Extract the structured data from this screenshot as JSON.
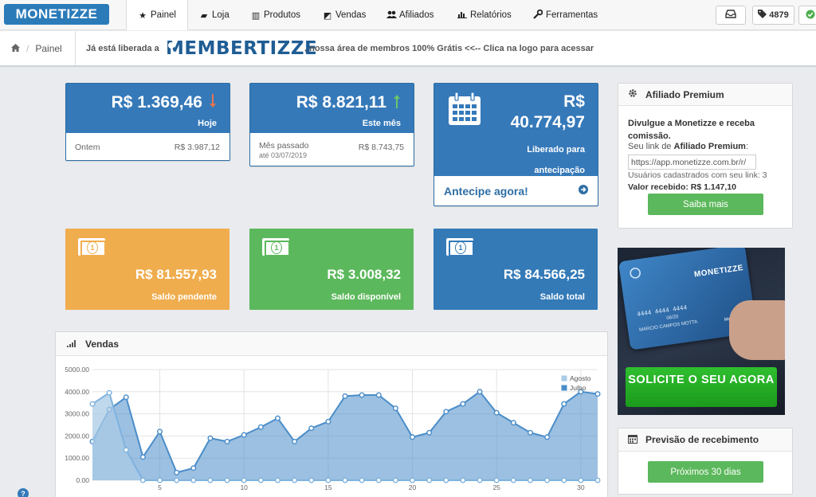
{
  "nav": {
    "logo": "MONETIZZE",
    "items": [
      {
        "label": "Painel",
        "icon": "★",
        "icon_name": "star-icon"
      },
      {
        "label": "Loja",
        "icon": "▰",
        "icon_name": "bag-icon"
      },
      {
        "label": "Produtos",
        "icon": "▥",
        "icon_name": "barcode-icon"
      },
      {
        "label": "Vendas",
        "icon": "◩",
        "icon_name": "money-icon"
      },
      {
        "label": "Afiliados",
        "icon": "👥",
        "icon_name": "users-icon"
      },
      {
        "label": "Relatórios",
        "icon": "▟",
        "icon_name": "chart-icon"
      },
      {
        "label": "Ferramentas",
        "icon": "🔧",
        "icon_name": "wrench-icon"
      }
    ],
    "inbox_icon": "inbox-icon",
    "points": "4879"
  },
  "breadcrumb": {
    "home_icon": "home-icon",
    "current": "Painel"
  },
  "notice": {
    "before": "Já está liberada a",
    "brand": "MEMBERTIZZE",
    "after": ", nossa área de membros 100% Grátis <<-- Clica na logo para acessar"
  },
  "stats": {
    "today": {
      "value": "R$ 1.369,46",
      "label": "Hoje",
      "foot_label": "Ontem",
      "foot_value": "R$ 3.987,12"
    },
    "month": {
      "value": "R$ 8.821,11",
      "label": "Este mês",
      "foot_label": "Mês passado",
      "foot_sub": "até 03/07/2019",
      "foot_value": "R$ 8.743,75"
    },
    "released": {
      "currency": "R$",
      "value": "40.774,97",
      "label": "Liberado para antecipação",
      "link": "Antecipe agora!"
    }
  },
  "balances": [
    {
      "value": "R$ 81.557,93",
      "label": "Saldo pendente",
      "color": "#f0ad4e"
    },
    {
      "value": "R$ 3.008,32",
      "label": "Saldo disponível",
      "color": "#5cb85c"
    },
    {
      "value": "R$ 84.566,25",
      "label": "Saldo total",
      "color": "#337ab7"
    }
  ],
  "affiliate": {
    "title": "Afiliado Premium",
    "desc": "Divulgue a Monetizze e receba comissão.",
    "link_label": "Seu link de",
    "link_strong": "Afiliado Premium",
    "link_value": "https://app.monetizze.com.br/r/",
    "users_text": "Usuários cadastrados com seu link: 3",
    "received_label": "Valor recebido:",
    "received_value": "R$ 1.147,10",
    "button": "Saiba mais"
  },
  "card_promo": {
    "brand": "MONETIZZE",
    "number": "4444 4444 4444",
    "date": "06/20",
    "holder": "MARCIO CAMPOS MOTTA",
    "network": "MasterCard",
    "cta": "SOLICITE O SEU AGORA"
  },
  "forecast": {
    "title": "Previsão de recebimento",
    "button": "Próximos 30 dias"
  },
  "sales_panel": {
    "title": "Vendas"
  },
  "chart_data": {
    "type": "area",
    "title": "",
    "xlabel": "",
    "ylabel": "",
    "ylim": [
      0,
      5000
    ],
    "y_ticks": [
      "0.00",
      "1000.00",
      "2000.00",
      "3000.00",
      "4000.00",
      "5000.00"
    ],
    "x_ticks": [
      5,
      10,
      15,
      20,
      25,
      30
    ],
    "xlim": [
      1,
      31
    ],
    "grid": true,
    "legend": "top-right",
    "series": [
      {
        "name": "Agosto",
        "color": "#a9cbe6",
        "x": [
          1,
          2,
          3,
          4,
          5,
          6,
          7,
          8,
          9,
          10,
          11,
          12,
          13,
          14,
          15,
          16,
          17,
          18,
          19,
          20,
          21,
          22,
          23,
          24,
          25,
          26,
          27,
          28,
          29,
          30,
          31
        ],
        "values": [
          3450,
          3950,
          1370,
          0,
          0,
          0,
          0,
          0,
          0,
          0,
          0,
          0,
          0,
          0,
          0,
          0,
          0,
          0,
          0,
          0,
          0,
          0,
          0,
          0,
          0,
          0,
          0,
          0,
          0,
          0,
          0
        ]
      },
      {
        "name": "Julho",
        "color": "#4a8dc9",
        "x": [
          1,
          2,
          3,
          4,
          5,
          6,
          7,
          8,
          9,
          10,
          11,
          12,
          13,
          14,
          15,
          16,
          17,
          18,
          19,
          20,
          21,
          22,
          23,
          24,
          25,
          26,
          27,
          28,
          29,
          30,
          31
        ],
        "values": [
          1750,
          3200,
          3750,
          1050,
          2200,
          350,
          550,
          1900,
          1750,
          2050,
          2400,
          2800,
          1750,
          2350,
          2650,
          3800,
          3850,
          3850,
          3250,
          1950,
          2150,
          3100,
          3450,
          4000,
          3050,
          2600,
          2150,
          1950,
          3450,
          4000,
          3900
        ]
      }
    ]
  }
}
